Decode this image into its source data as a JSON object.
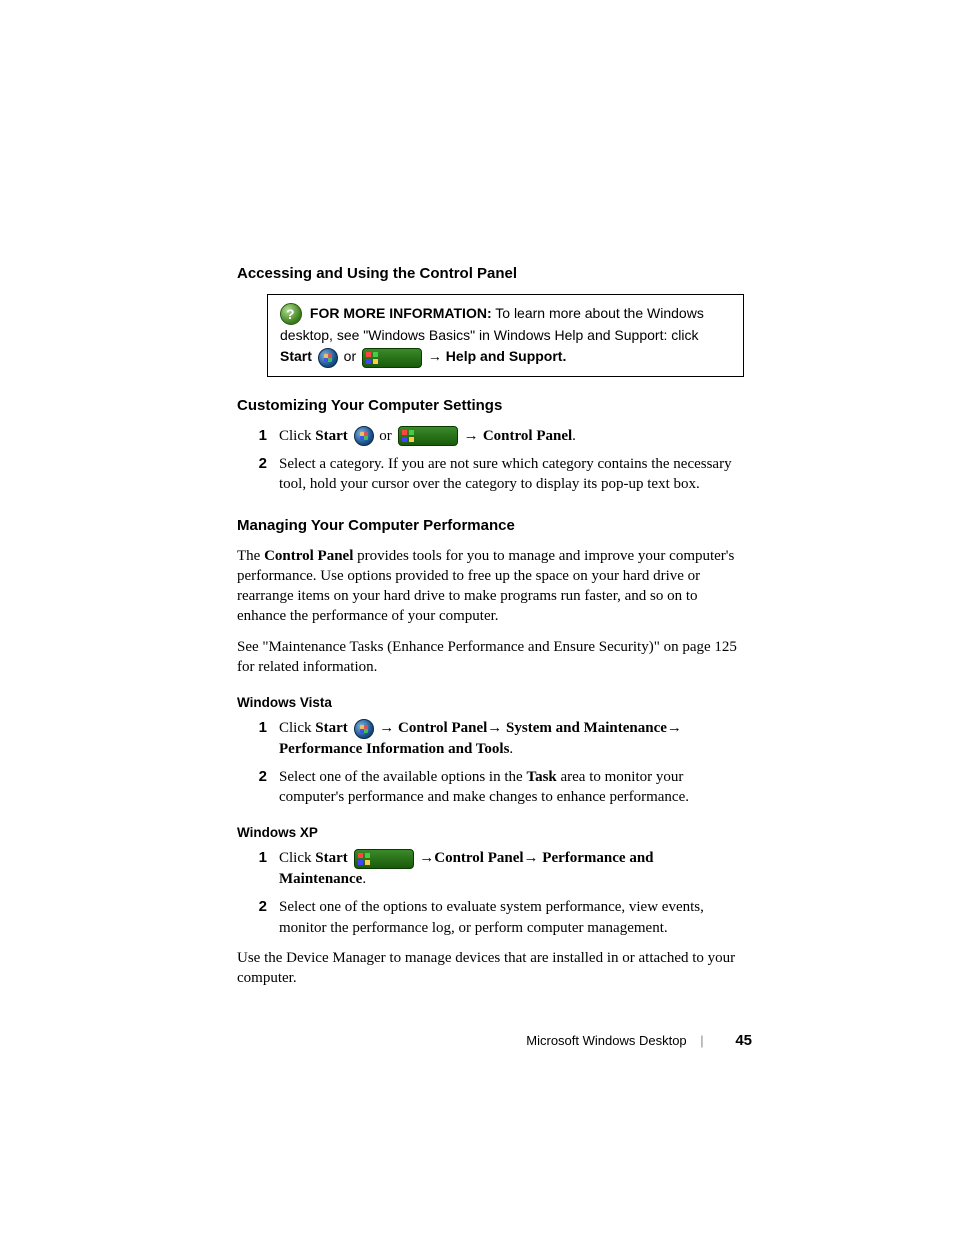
{
  "section1": {
    "title": "Accessing and Using the Control Panel",
    "info": {
      "label": "FOR MORE INFORMATION:",
      "text1": " To learn more about the Windows desktop, see \"Windows Basics\" in Windows Help and Support: click ",
      "start": "Start",
      "or": " or ",
      "arrow_help": " → Help and Support."
    }
  },
  "section2": {
    "title": "Customizing Your Computer Settings",
    "steps": [
      {
        "num": "1",
        "pre": "Click ",
        "start": "Start",
        "or": " or ",
        "post_arrow": " → ",
        "cp": "Control Panel",
        "end": "."
      },
      {
        "num": "2",
        "text": "Select a category. If you are not sure which category contains the necessary tool, hold your cursor over the category to display its pop-up text box."
      }
    ]
  },
  "section3": {
    "title": "Managing Your Computer Performance",
    "p1_a": "The ",
    "p1_b": "Control Panel",
    "p1_c": " provides tools for you to manage and improve your computer's performance. Use options provided to free up the space on your hard drive or rearrange items on your hard drive to make programs run faster, and so on to enhance the performance of your computer.",
    "p2": "See \"Maintenance Tasks (Enhance Performance and Ensure Security)\" on page 125 for related information.",
    "vista": {
      "title": "Windows Vista",
      "steps": [
        {
          "num": "1",
          "pre": "Click ",
          "start": "Start",
          "path": " → Control Panel→ System and Maintenance→ Performance Information and Tools",
          "end": "."
        },
        {
          "num": "2",
          "pre": "Select one of the available options in the ",
          "task": "Task",
          "post": " area to monitor your computer's performance and make changes to enhance performance."
        }
      ]
    },
    "xp": {
      "title": "Windows XP",
      "steps": [
        {
          "num": "1",
          "pre": "Click ",
          "start": "Start",
          "path": " →Control Panel→ Performance and Maintenance",
          "end": "."
        },
        {
          "num": "2",
          "text": "Select one of the options to evaluate system performance, view events, monitor the performance log, or perform computer management."
        }
      ]
    },
    "p3": "Use the Device Manager to manage devices that are installed in or attached to your computer."
  },
  "footer": {
    "title": "Microsoft Windows Desktop",
    "page": "45"
  }
}
